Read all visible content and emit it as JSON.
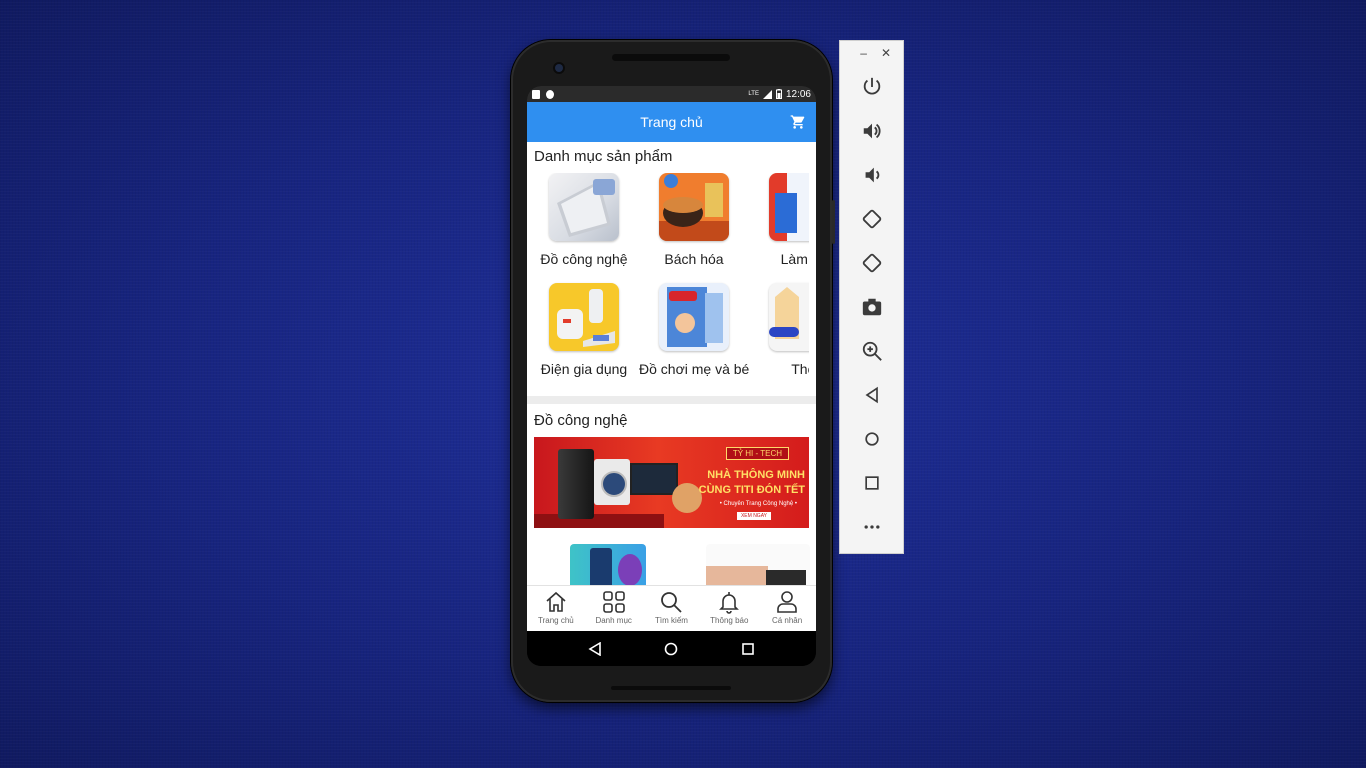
{
  "statusbar": {
    "time": "12:06",
    "network": "LTE"
  },
  "appbar": {
    "title": "Trang chủ"
  },
  "categories_section": {
    "title": "Danh mục sản phẩm",
    "items": [
      {
        "label": "Đồ công nghệ",
        "image": "laptop"
      },
      {
        "label": "Bách hóa",
        "image": "food"
      },
      {
        "label": "Làm đẹ",
        "image": "cosmetics"
      },
      {
        "label": "Điện gia dụng",
        "image": "appliances"
      },
      {
        "label": "Đồ chơi mẹ và bé",
        "image": "diapers"
      },
      {
        "label": "Thờ",
        "image": "fashion"
      }
    ]
  },
  "tech_section": {
    "title": "Đồ công nghệ",
    "banner": {
      "badge": "TỶ HI - TECH",
      "line1": "NHÀ THÔNG MINH",
      "line2": "CÙNG TITI ĐÓN TẾT",
      "line3": "• Chuyên Trang Công Nghệ •",
      "cta": "XEM NGAY"
    }
  },
  "bottom_nav": [
    {
      "label": "Trang chủ",
      "icon": "home-icon"
    },
    {
      "label": "Danh mục",
      "icon": "grid-icon"
    },
    {
      "label": "Tìm kiếm",
      "icon": "search-icon"
    },
    {
      "label": "Thông báo",
      "icon": "bell-icon"
    },
    {
      "label": "Cá nhân",
      "icon": "person-icon"
    }
  ],
  "emulator_toolbar": {
    "window_controls": {
      "minimize": "–",
      "close": "✕"
    },
    "tools": [
      "power-icon",
      "volume-up-icon",
      "volume-down-icon",
      "rotate-left-icon",
      "rotate-right-icon",
      "camera-icon",
      "zoom-icon",
      "back-icon",
      "home-icon",
      "overview-icon",
      "more-icon"
    ]
  },
  "colors": {
    "appbar": "#2f8ff0",
    "background": "#17247f",
    "banner_red": "#d41c1c"
  }
}
